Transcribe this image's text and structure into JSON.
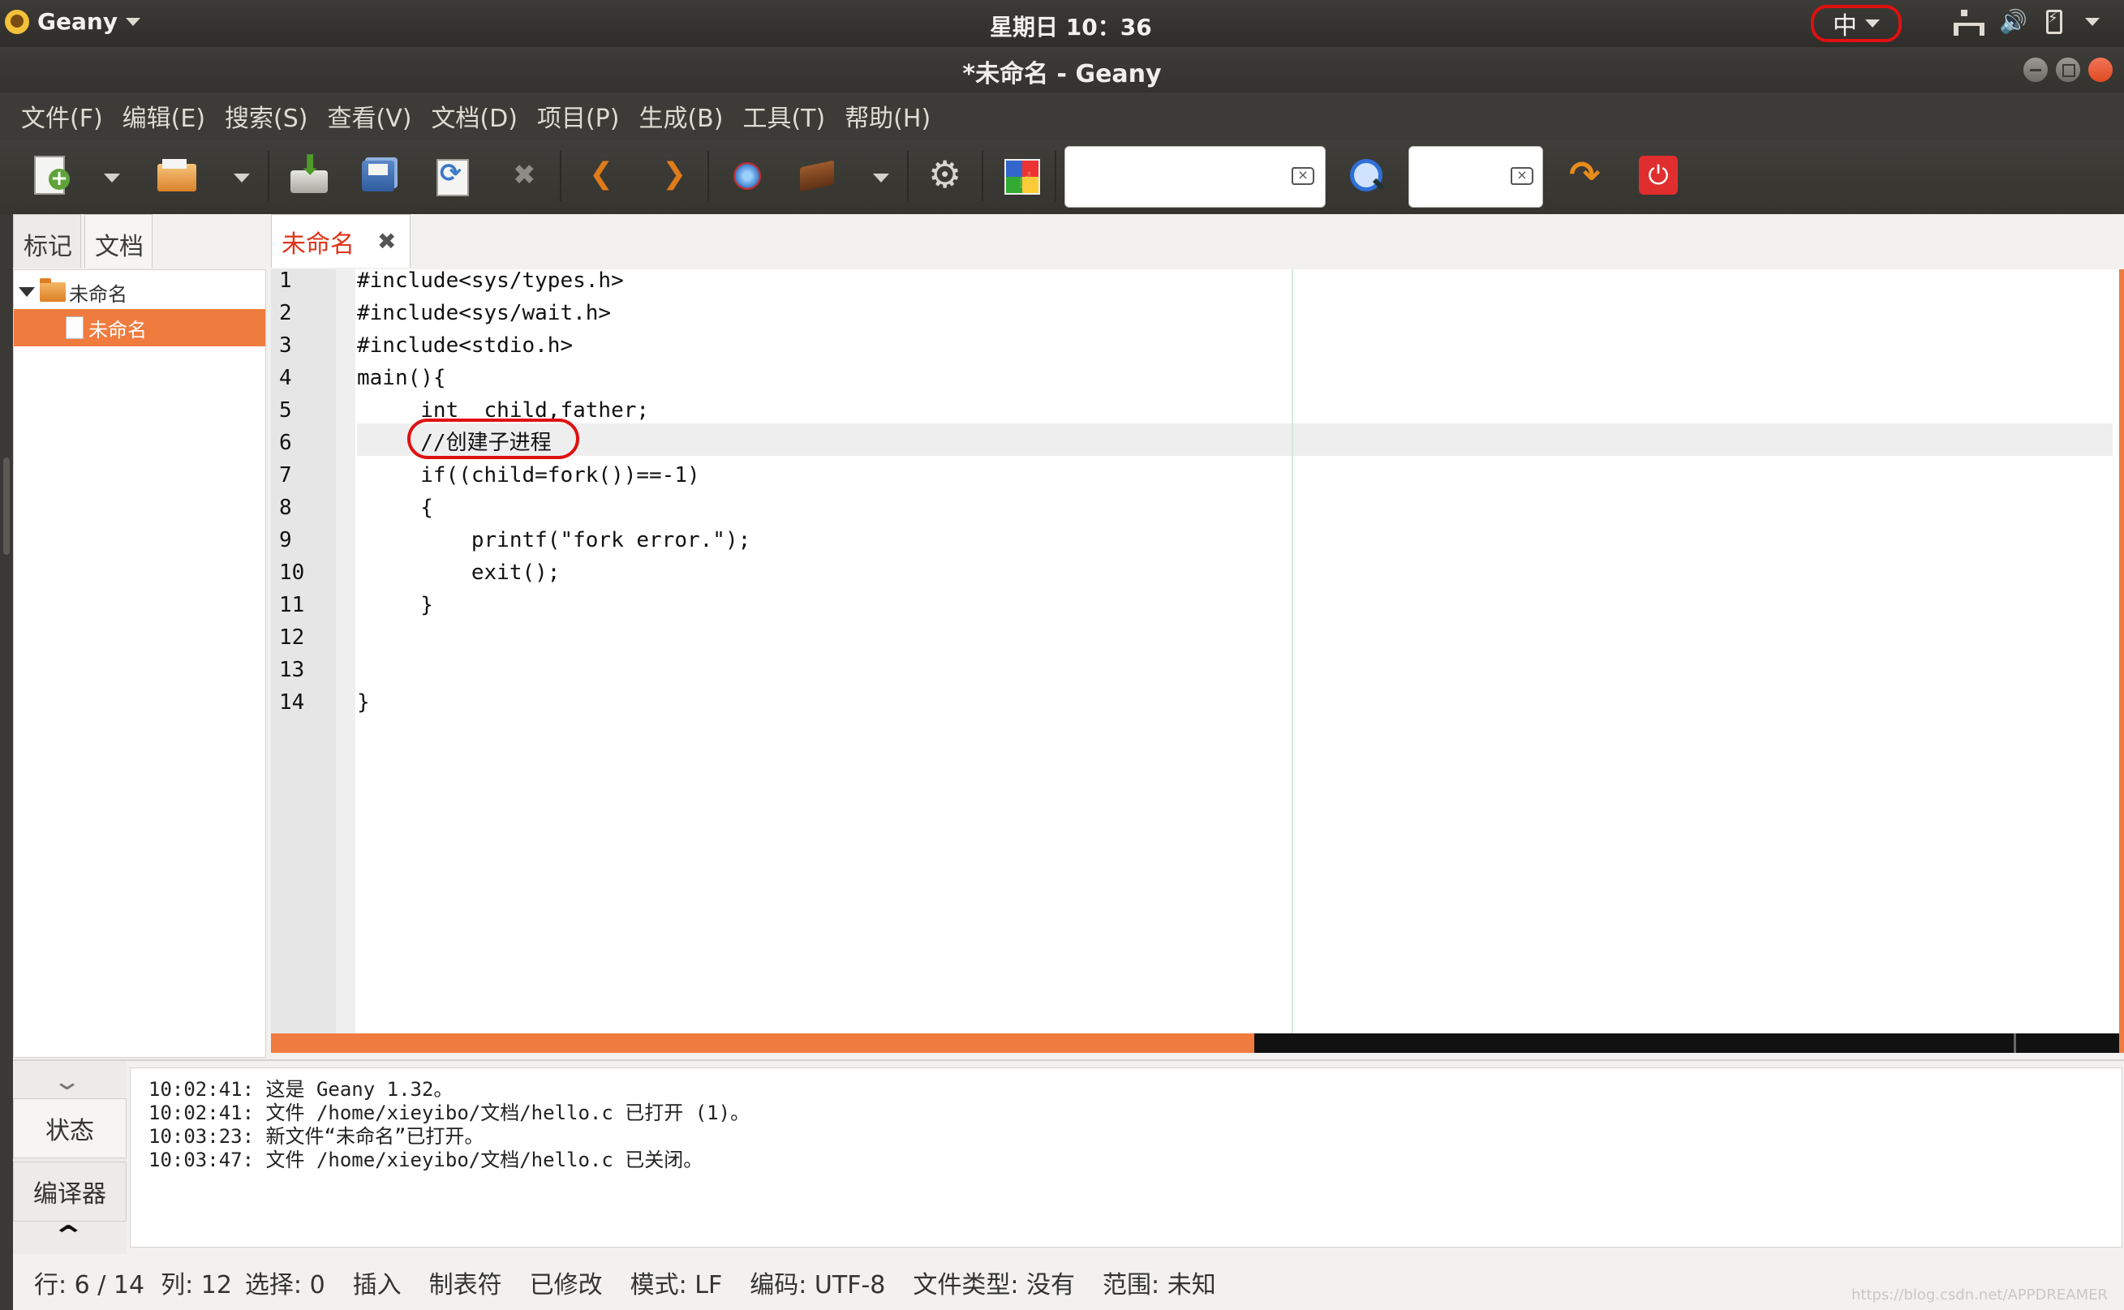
{
  "top_panel": {
    "app_name": "Geany",
    "clock": "星期日 10：36",
    "input_method": "中"
  },
  "window": {
    "title": "*未命名 - Geany"
  },
  "menu": [
    "文件(F)",
    "编辑(E)",
    "搜索(S)",
    "查看(V)",
    "文档(D)",
    "项目(P)",
    "生成(B)",
    "工具(T)",
    "帮助(H)"
  ],
  "toolbar": {
    "search_value": "",
    "goto_value": ""
  },
  "sidebar": {
    "tabs": [
      "标记",
      "文档"
    ],
    "folder": "未命名",
    "file": "未命名"
  },
  "editor": {
    "tab_label": "未命名",
    "close_glyph": "✖",
    "line_numbers": [
      "1",
      "2",
      "3",
      "4",
      "5",
      "6",
      "7",
      "8",
      "9",
      "10",
      "11",
      "12",
      "13",
      "14"
    ],
    "lines": [
      "#include<sys/types.h>",
      "#include<sys/wait.h>",
      "#include<stdio.h>",
      "main(){",
      "     int  child,father;",
      "     //创建子进程",
      "     if((child=fork())==-1)",
      "     {",
      "         printf(\"fork error.\");",
      "         exit();",
      "     }",
      "",
      "",
      "}"
    ]
  },
  "messages": {
    "tabs": [
      "状态",
      "编译器"
    ],
    "log": [
      "10:02:41: 这是 Geany 1.32。",
      "10:02:41: 文件 /home/xieyibo/文档/hello.c 已打开 (1)。",
      "10:03:23: 新文件“未命名”已打开。",
      "10:03:47: 文件 /home/xieyibo/文档/hello.c 已关闭。"
    ]
  },
  "statusbar": {
    "line": "行: 6 / 14",
    "col": "列: 12",
    "sel": "选择: 0",
    "mode_insert": "插入",
    "indent": "制表符",
    "modified": "已修改",
    "eol": "模式: LF",
    "encoding": "编码: UTF-8",
    "filetype": "文件类型: 没有",
    "scope": "范围: 未知"
  },
  "watermark": "https://blog.csdn.net/APPDREAMER"
}
